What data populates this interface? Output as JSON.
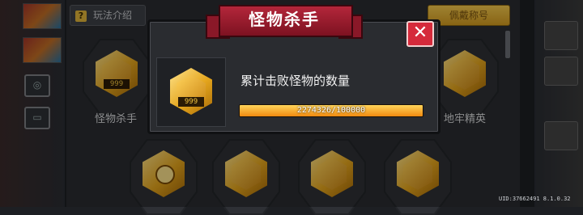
{
  "help_tab": {
    "label": "玩法介绍"
  },
  "equip_button": {
    "label": "佩戴称号"
  },
  "badges": [
    {
      "label": "怪物杀手",
      "tag": "999"
    },
    {
      "label": "地牢精英"
    }
  ],
  "modal": {
    "title": "怪物杀手",
    "badge_tag": "999",
    "description": "累计击败怪物的数量",
    "progress_text": "2274326/100000",
    "progress_fraction": 1.0,
    "close_label": "✕"
  },
  "footer": {
    "uid": "UID:37662491 8.1.0.32"
  },
  "colors": {
    "accent": "#d52a3b",
    "gold": "#e4a51d",
    "ribbon": "#b3263a"
  }
}
